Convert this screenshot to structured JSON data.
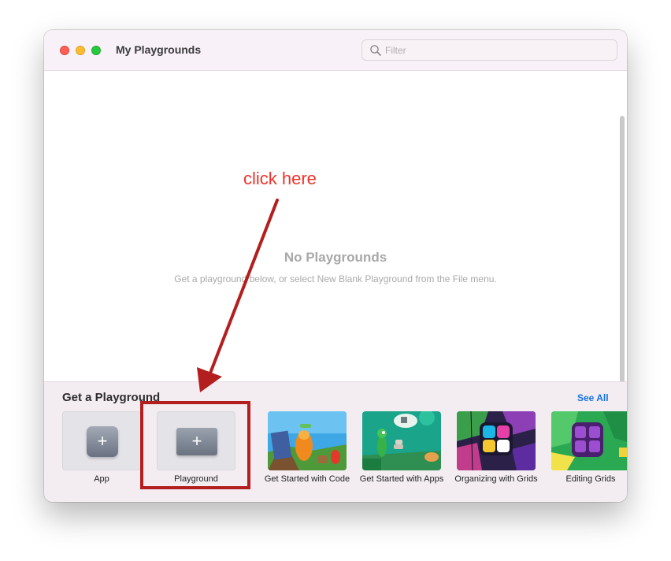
{
  "window": {
    "title": "My Playgrounds"
  },
  "filter": {
    "placeholder": "Filter",
    "value": ""
  },
  "empty_state": {
    "title": "No Playgrounds",
    "subtitle": "Get a playground below, or select New Blank Playground from the File menu."
  },
  "get_playground": {
    "title": "Get a Playground",
    "see_all": "See All",
    "items": [
      {
        "label": "App",
        "icon": "plus-icon"
      },
      {
        "label": "Playground",
        "icon": "plus-icon"
      },
      {
        "label": "Get Started with Code"
      },
      {
        "label": "Get Started with Apps"
      },
      {
        "label": "Organizing with Grids"
      },
      {
        "label": "Editing Grids"
      }
    ]
  },
  "annotation": {
    "text": "click here",
    "color": "#f0322a",
    "box_color": "#b31e1e"
  },
  "colors": {
    "accent": "#1673e6",
    "titlebar": "#f8f1f7",
    "bottom_panel": "#f3edf2"
  }
}
